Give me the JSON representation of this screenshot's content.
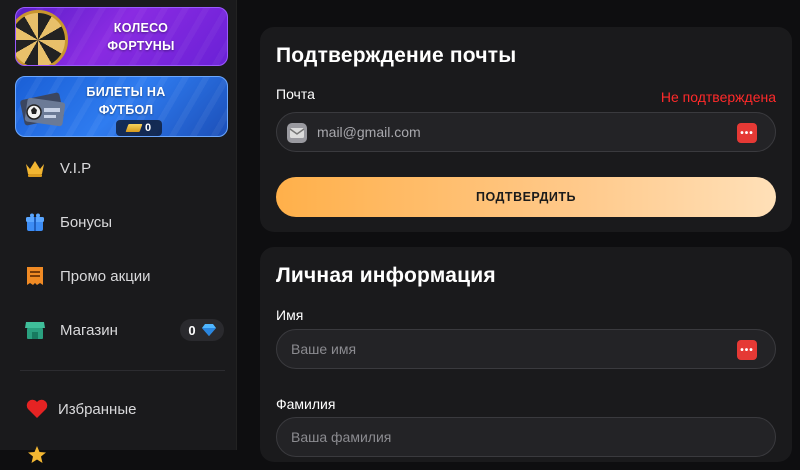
{
  "sidebar": {
    "promos": {
      "wheel_title": "КОЛЕСО\nФОРТУНЫ",
      "tickets_title": "БИЛЕТЫ НА\nФУТБОЛ",
      "tickets_count": "0"
    },
    "items": [
      {
        "label": "V.I.P",
        "icon": "crown-icon"
      },
      {
        "label": "Бонусы",
        "icon": "gift-icon"
      },
      {
        "label": "Промо акции",
        "icon": "promo-ticket-icon"
      },
      {
        "label": "Магазин",
        "icon": "shop-icon",
        "badge": "0"
      },
      {
        "label": "Избранные",
        "icon": "heart-icon"
      }
    ]
  },
  "email_card": {
    "title": "Подтверждение почты",
    "email_label": "Почта",
    "status": "Не подтверждена",
    "email_value": "mail@gmail.com",
    "confirm_label": "ПОДТВЕРДИТЬ"
  },
  "personal_card": {
    "title": "Личная информация",
    "name_label": "Имя",
    "name_placeholder": "Ваше имя",
    "surname_label": "Фамилия",
    "surname_placeholder": "Ваша фамилия"
  },
  "colors": {
    "accent_orange": "#ffb04a",
    "status_red": "#ff2a2a",
    "wheel_purple": "#8a2be2",
    "tickets_blue": "#2f7cf0"
  }
}
